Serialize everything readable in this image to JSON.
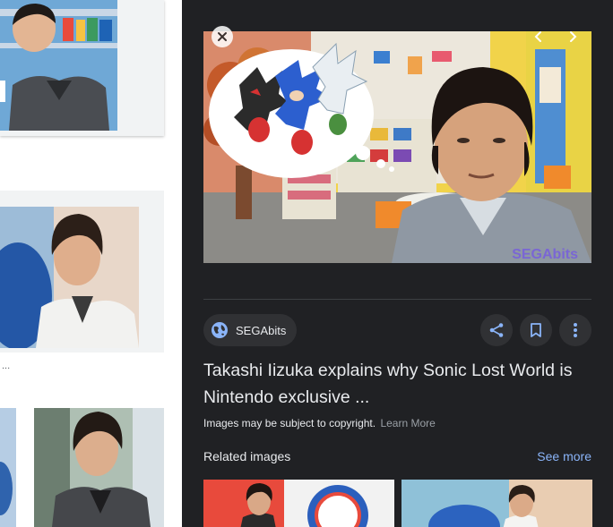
{
  "panel": {
    "source": {
      "name": "SEGAbits",
      "icon": "globe-icon"
    },
    "title": "Takashi Iizuka explains why Sonic Lost World is Nintendo exclusive ...",
    "copyright_text": "Images may be subject to copyright.",
    "learn_more": "Learn More",
    "watermark": "SEGAbits",
    "related_title": "Related images",
    "see_more": "See more",
    "actions": [
      "share-icon",
      "bookmark-icon",
      "more-vert-icon"
    ],
    "nav": [
      "close-icon",
      "chevron-left-icon",
      "chevron-right-icon"
    ]
  },
  "left": {
    "caption_fragment": "..."
  },
  "colors": {
    "panel_bg": "#202124",
    "chip_bg": "#303134",
    "link": "#8ab4f8",
    "text": "#e8eaed",
    "muted": "#9aa0a6"
  }
}
